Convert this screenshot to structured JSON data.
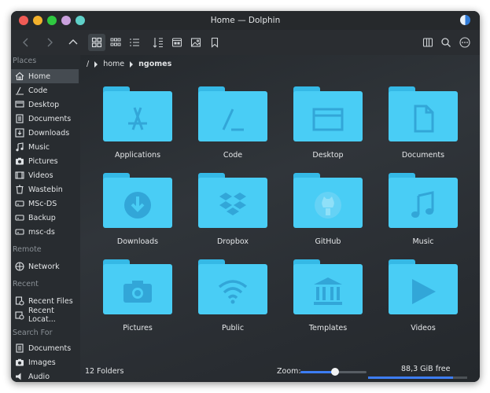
{
  "window": {
    "title": "Home — Dolphin"
  },
  "traffic_colors": [
    "#ef5b55",
    "#f2b12c",
    "#2fc840",
    "#c9a0dc",
    "#5fd0c8"
  ],
  "toolbar": {
    "icons": [
      "back-icon",
      "forward-icon",
      "up-icon",
      "icons-view-icon",
      "compact-view-icon",
      "details-view-icon",
      "sort-icon",
      "preview-icon",
      "image-icon",
      "bookmark-icon",
      "split-icon",
      "search-icon",
      "menu-icon"
    ]
  },
  "sidebar": {
    "places_title": "Places",
    "places": [
      {
        "label": "Home",
        "icon": "home-icon",
        "active": true
      },
      {
        "label": "Code",
        "icon": "terminal-icon"
      },
      {
        "label": "Desktop",
        "icon": "desktop-icon"
      },
      {
        "label": "Documents",
        "icon": "documents-icon"
      },
      {
        "label": "Downloads",
        "icon": "downloads-icon"
      },
      {
        "label": "Music",
        "icon": "music-icon"
      },
      {
        "label": "Pictures",
        "icon": "camera-icon"
      },
      {
        "label": "Videos",
        "icon": "video-icon"
      },
      {
        "label": "Wastebin",
        "icon": "trash-icon"
      },
      {
        "label": "MSc-DS",
        "icon": "drive-icon"
      },
      {
        "label": "Backup",
        "icon": "drive-icon"
      },
      {
        "label": "msc-ds",
        "icon": "drive-icon"
      }
    ],
    "remote_title": "Remote",
    "remote": [
      {
        "label": "Network",
        "icon": "network-icon"
      }
    ],
    "recent_title": "Recent",
    "recent": [
      {
        "label": "Recent Files",
        "icon": "recent-files-icon"
      },
      {
        "label": "Recent Locat...",
        "icon": "recent-locations-icon"
      }
    ],
    "search_title": "Search For",
    "search": [
      {
        "label": "Documents",
        "icon": "documents-icon"
      },
      {
        "label": "Images",
        "icon": "camera-icon"
      },
      {
        "label": "Audio",
        "icon": "audio-icon"
      }
    ]
  },
  "breadcrumb": {
    "root": "/",
    "parent": "home",
    "current": "ngomes"
  },
  "folders": [
    {
      "label": "Applications",
      "icon": "apps-icon"
    },
    {
      "label": "Code",
      "icon": "terminal-icon"
    },
    {
      "label": "Desktop",
      "icon": "desktop-icon"
    },
    {
      "label": "Documents",
      "icon": "document-icon"
    },
    {
      "label": "Downloads",
      "icon": "download-icon"
    },
    {
      "label": "Dropbox",
      "icon": "dropbox-icon"
    },
    {
      "label": "GitHub",
      "icon": "github-icon"
    },
    {
      "label": "Music",
      "icon": "music-icon"
    },
    {
      "label": "Pictures",
      "icon": "camera-icon"
    },
    {
      "label": "Public",
      "icon": "wifi-icon"
    },
    {
      "label": "Templates",
      "icon": "templates-icon"
    },
    {
      "label": "Videos",
      "icon": "play-icon"
    }
  ],
  "status": {
    "folder_count": "12 Folders",
    "zoom_label": "Zoom:",
    "zoom_level": 0.52,
    "free_space": "88,3 GiB free",
    "used_fraction": 0.86
  }
}
